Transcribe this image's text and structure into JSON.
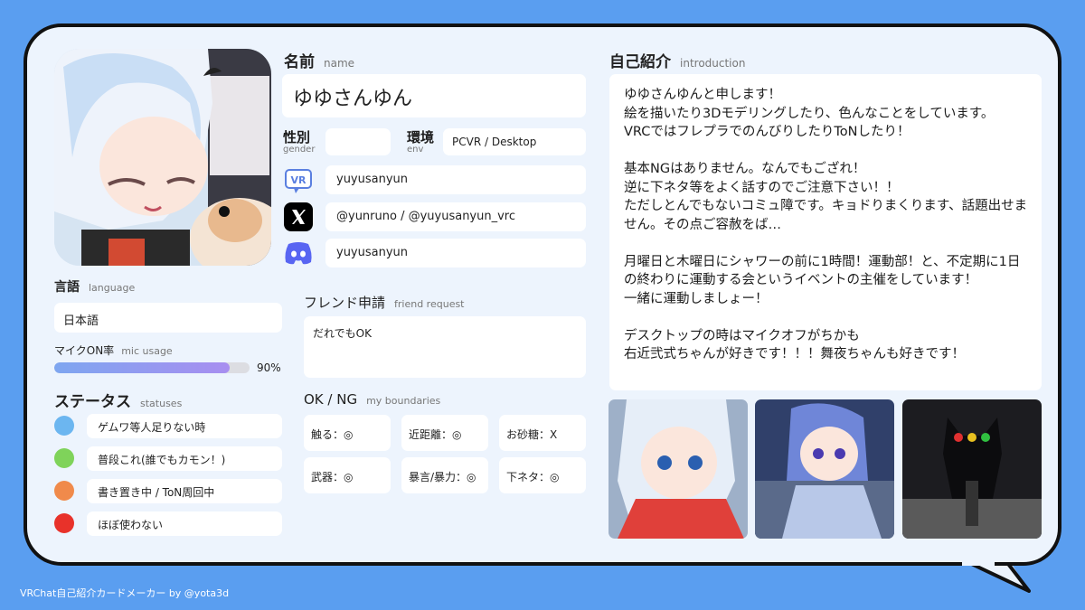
{
  "name": {
    "label": "名前",
    "label_en": "name",
    "value": "ゆゆさんゆん"
  },
  "gender": {
    "label": "性別",
    "label_en": "gender",
    "value": ""
  },
  "env": {
    "label": "環境",
    "label_en": "env",
    "value": "PCVR / Desktop"
  },
  "socials": [
    {
      "icon": "vrchat-icon",
      "value": "yuyusanyun"
    },
    {
      "icon": "x-icon",
      "value": "@yunruno / @yuyusanyun_vrc"
    },
    {
      "icon": "discord-icon",
      "value": "yuyusanyun"
    }
  ],
  "language": {
    "label": "言語",
    "label_en": "language",
    "value": "日本語"
  },
  "mic": {
    "label": "マイクON率",
    "label_en": "mic usage",
    "value_text": "90%",
    "fraction": 0.9
  },
  "statuses": {
    "label": "ステータス",
    "label_en": "statuses",
    "items": [
      {
        "color": "#6cb6f0",
        "text": "ゲムワ等人足りない時"
      },
      {
        "color": "#7fd35a",
        "text": "普段これ(誰でもカモン！)"
      },
      {
        "color": "#f08a4b",
        "text": "書き置き中 / ToN周回中"
      },
      {
        "color": "#e8322a",
        "text": "ほぼ使わない"
      }
    ]
  },
  "friend_request": {
    "label": "フレンド申請",
    "label_en": "friend request",
    "value": "だれでもOK"
  },
  "boundaries": {
    "label": "OK / NG",
    "label_en": "my boundaries",
    "items": [
      "触る：◎",
      "近距離：◎",
      "お砂糖：X",
      "武器：◎",
      "暴言/暴力：◎",
      "下ネタ：◎"
    ]
  },
  "introduction": {
    "label": "自己紹介",
    "label_en": "introduction",
    "text": "ゆゆさんゆんと申します！\n絵を描いたり3Dモデリングしたり、色んなことをしています。\nVRCではフレプラでのんびりしたりToNしたり！\n\n基本NGはありません。なんでもござれ！\n逆に下ネタ等をよく話すのでご注意下さい！！\nただしとんでもないコミュ障です。キョドりまくります、話題出せません。その点ご容赦をば…\n\n月曜日と木曜日にシャワーの前に1時間！運動部！と、不定期に1日の終わりに運動する会というイベントの主催をしています！\n一緒に運動しましょー！\n\nデスクトップの時はマイクオフがちかも\n右近弐式ちゃんが好きです！！！舞夜ちゃんも好きです！"
  },
  "footer": "VRChat自己紹介カードメーカー by @yota3d",
  "colors": {
    "background": "#5a9ef0",
    "card": "#edf4fd",
    "mic_bar": "#8aa2f0"
  }
}
